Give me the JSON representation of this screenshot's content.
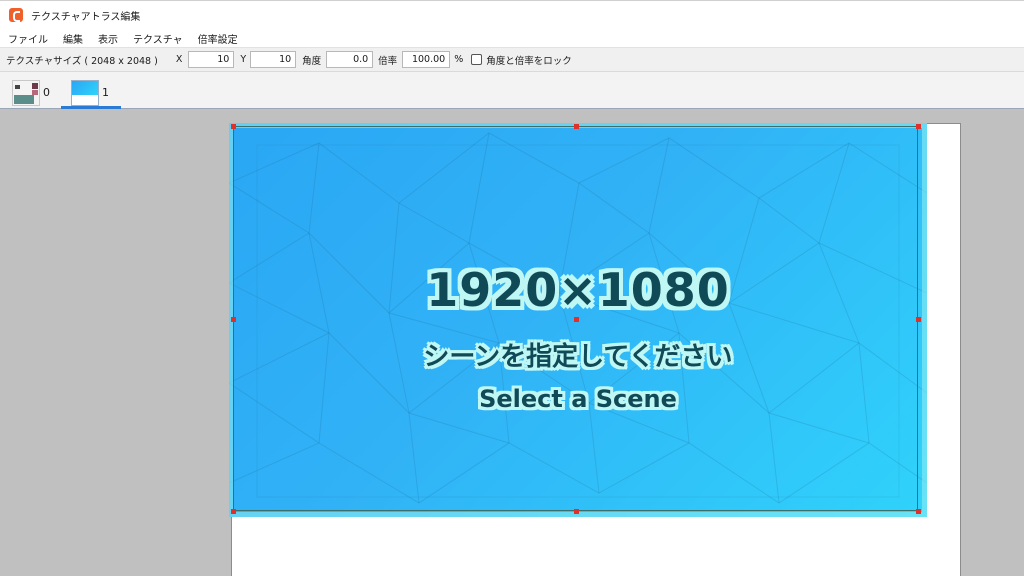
{
  "window": {
    "title": "テクスチャアトラス編集",
    "app_icon": "app-logo-icon",
    "accent": "#f0602b"
  },
  "menu": [
    "ファイル",
    "編集",
    "表示",
    "テクスチャ",
    "倍率設定"
  ],
  "toolbar": {
    "texture_size_label": "テクスチャサイズ ( 2048 x 2048 )",
    "x_label": "X",
    "x_value": "10",
    "y_label": "Y",
    "y_value": "10",
    "angle_label": "角度",
    "angle_value": "0.0",
    "scale_label": "倍率",
    "scale_value": "100.00",
    "scale_unit": "%",
    "lock_label": "角度と倍率をロック",
    "lock_checked": false
  },
  "tabs": [
    {
      "label": "0",
      "active": false
    },
    {
      "label": "1",
      "active": true
    }
  ],
  "scene": {
    "resolution": "1920×1080",
    "prompt_jp": "シーンを指定してください",
    "prompt_en": "Select a Scene",
    "text_color": "#114a57",
    "outline_color": "#bff7f5",
    "gradient": [
      "#2aa7f4",
      "#2fd3fb"
    ]
  },
  "colors": {
    "canvas_bg": "#c0c0c0",
    "handle": "#e0302a",
    "tab_active": "#2b7bd6"
  }
}
